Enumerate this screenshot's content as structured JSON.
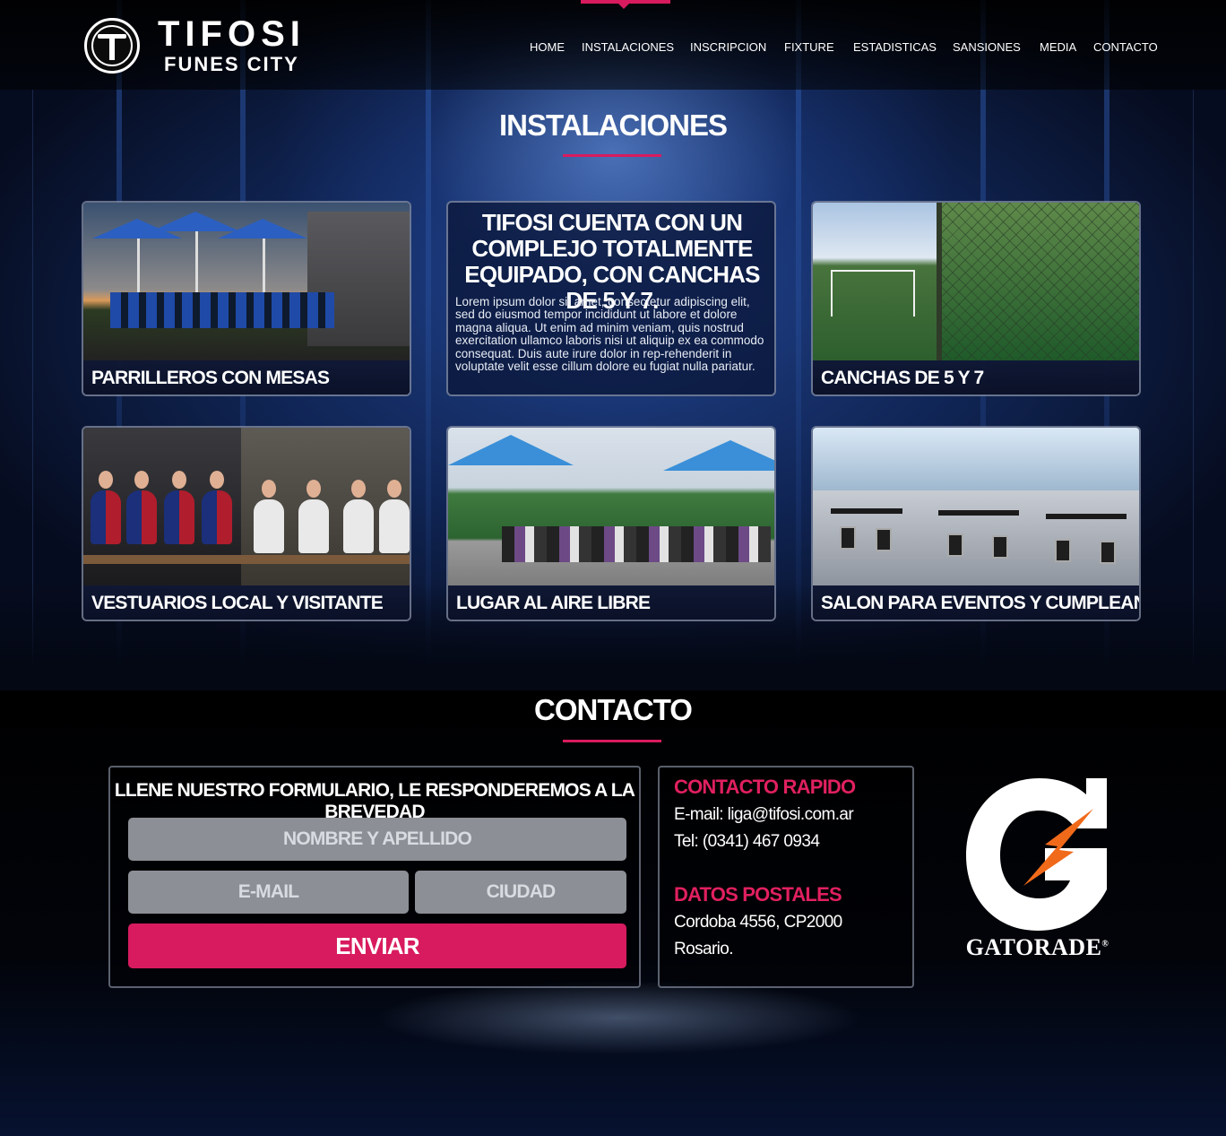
{
  "brand": {
    "title": "TIFOSI",
    "subtitle": "FUNES CITY"
  },
  "nav": {
    "items": [
      "HOME",
      "INSTALACIONES",
      "INSCRIPCION",
      "FIXTURE",
      "ESTADISTICAS",
      "SANSIONES",
      "MEDIA",
      "CONTACTO"
    ],
    "active": "INSTALACIONES"
  },
  "instalaciones": {
    "title": "INSTALACIONES",
    "intro_title": "TIFOSI CUENTA CON UN COMPLEJO TOTALMENTE EQUIPADO, CON CANCHAS DE 5 Y 7.",
    "intro_body": "Lorem ipsum dolor sit amet, consectetur adipiscing elit, sed do eiusmod tempor incididunt ut labore et dolore magna aliqua. Ut enim ad minim veniam, quis nostrud exercitation ullamco laboris nisi ut aliquip ex ea commodo consequat. Duis aute irure dolor in rep-rehenderit in voluptate velit esse cillum dolore eu fugiat nulla pariatur.",
    "cards": [
      {
        "caption": "PARRILLEROS CON MESAS"
      },
      {
        "caption": "CANCHAS DE 5 Y 7"
      },
      {
        "caption": "VESTUARIOS LOCAL Y VISITANTE"
      },
      {
        "caption": "LUGAR AL AIRE LIBRE"
      },
      {
        "caption": "SALON PARA EVENTOS Y CUMPLEANOS"
      }
    ]
  },
  "contacto": {
    "title": "CONTACTO",
    "form": {
      "heading": "LLENE NUESTRO FORMULARIO, LE RESPONDEREMOS A LA BREVEDAD",
      "name_placeholder": "NOMBRE Y APELLIDO",
      "email_placeholder": "E-MAIL",
      "city_placeholder": "CIUDAD",
      "submit_label": "ENVIAR"
    },
    "quick": {
      "heading": "CONTACTO RAPIDO",
      "email": "E-mail: liga@tifosi.com.ar",
      "phone": "Tel: (0341) 467 0934"
    },
    "postal": {
      "heading": "DATOS POSTALES",
      "address": "Cordoba 4556, CP2000",
      "city": "Rosario."
    },
    "sponsor": {
      "name": "GATORADE",
      "mark": "®"
    }
  },
  "colors": {
    "accent": "#d81b5e",
    "field": "#8c8f96",
    "background": "#02050c"
  },
  "icons": {
    "logo": "tifosi-emblem-icon",
    "sponsor": "gatorade-logo-icon"
  }
}
